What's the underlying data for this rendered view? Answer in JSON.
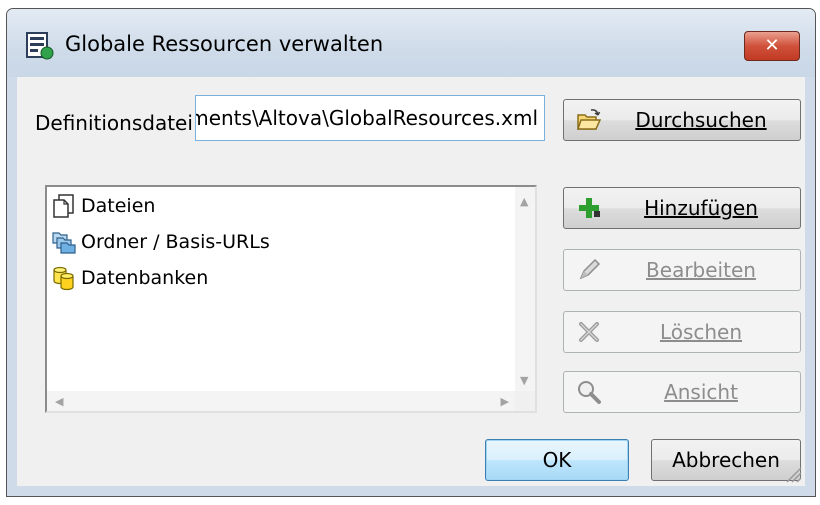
{
  "window": {
    "title": "Globale Ressourcen verwalten",
    "close_label": "✕"
  },
  "definition": {
    "label": "Definitionsdatei:",
    "value": "ments\\Altova\\GlobalResources.xml",
    "browse_label": "Durchsuchen"
  },
  "tree": {
    "items": [
      {
        "label": "Dateien",
        "icon": "files-icon"
      },
      {
        "label": "Ordner / Basis-URLs",
        "icon": "folders-icon"
      },
      {
        "label": "Datenbanken",
        "icon": "databases-icon"
      }
    ]
  },
  "actions": {
    "add_label": "Hinzufügen",
    "edit_label": "Bearbeiten",
    "delete_label": "Löschen",
    "view_label": "Ansicht"
  },
  "footer": {
    "ok_label": "OK",
    "cancel_label": "Abbrechen"
  },
  "colors": {
    "accent": "#3c7fb1",
    "close": "#c23a23",
    "add_icon": "#2e9e2e"
  }
}
